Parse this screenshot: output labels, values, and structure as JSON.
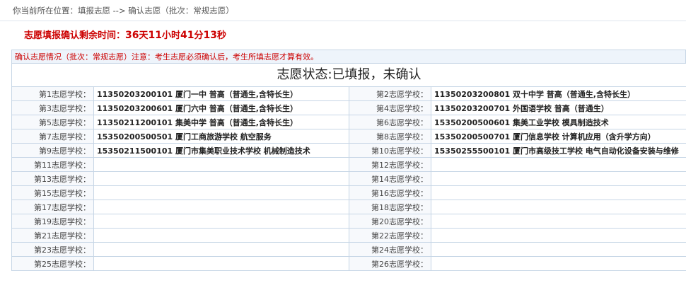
{
  "breadcrumb": "你当前所在位置：填报志愿 --> 确认志愿（批次：常规志愿）",
  "countdown": {
    "label": "志愿填报确认剩余时间：",
    "days": "36",
    "day_unit": "天",
    "hours": "11",
    "hour_unit": "小时",
    "minutes": "41",
    "minute_unit": "分",
    "seconds": "13",
    "second_unit": "秒"
  },
  "notice": "确认志愿情况（批次：常规志愿）注意：考生志愿必须确认后，考生所填志愿才算有效。",
  "status": "志愿状态:已填报，未确认",
  "choices": [
    {
      "label": "第1志愿学校：",
      "value": "11350203200101 厦门一中 普高（普通生,含特长生）"
    },
    {
      "label": "第2志愿学校：",
      "value": "11350203200801 双十中学 普高（普通生,含特长生）"
    },
    {
      "label": "第3志愿学校：",
      "value": "11350203200601 厦门六中 普高（普通生,含特长生）"
    },
    {
      "label": "第4志愿学校：",
      "value": "11350203200701 外国语学校 普高（普通生）"
    },
    {
      "label": "第5志愿学校：",
      "value": "11350211200101 集美中学 普高（普通生,含特长生）"
    },
    {
      "label": "第6志愿学校：",
      "value": "15350200500601 集美工业学校 模具制造技术"
    },
    {
      "label": "第7志愿学校：",
      "value": "15350200500501 厦门工商旅游学校 航空服务"
    },
    {
      "label": "第8志愿学校：",
      "value": "15350200500701 厦门信息学校 计算机应用（含升学方向）"
    },
    {
      "label": "第9志愿学校：",
      "value": "15350211500101 厦门市集美职业技术学校 机械制造技术"
    },
    {
      "label": "第10志愿学校：",
      "value": "15350255500101 厦门市高级技工学校 电气自动化设备安装与维修"
    },
    {
      "label": "第11志愿学校：",
      "value": ""
    },
    {
      "label": "第12志愿学校：",
      "value": ""
    },
    {
      "label": "第13志愿学校：",
      "value": ""
    },
    {
      "label": "第14志愿学校：",
      "value": ""
    },
    {
      "label": "第15志愿学校：",
      "value": ""
    },
    {
      "label": "第16志愿学校：",
      "value": ""
    },
    {
      "label": "第17志愿学校：",
      "value": ""
    },
    {
      "label": "第18志愿学校：",
      "value": ""
    },
    {
      "label": "第19志愿学校：",
      "value": ""
    },
    {
      "label": "第20志愿学校：",
      "value": ""
    },
    {
      "label": "第21志愿学校：",
      "value": ""
    },
    {
      "label": "第22志愿学校：",
      "value": ""
    },
    {
      "label": "第23志愿学校：",
      "value": ""
    },
    {
      "label": "第24志愿学校：",
      "value": ""
    },
    {
      "label": "第25志愿学校：",
      "value": ""
    },
    {
      "label": "第26志愿学校：",
      "value": ""
    }
  ]
}
